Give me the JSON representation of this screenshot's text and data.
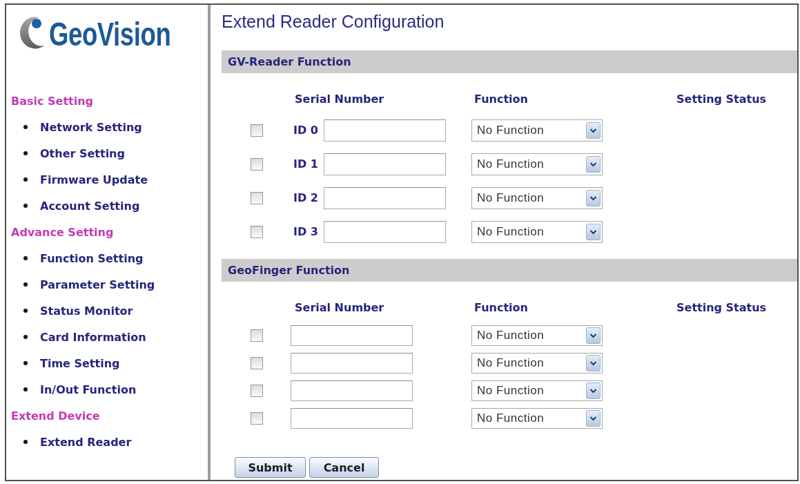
{
  "logo": {
    "text": "GeoVision"
  },
  "sidebar": {
    "groups": [
      {
        "title": "Basic Setting",
        "items": [
          "Network Setting",
          "Other Setting",
          "Firmware Update",
          "Account Setting"
        ]
      },
      {
        "title": "Advance Setting",
        "items": [
          "Function Setting",
          "Parameter Setting",
          "Status Monitor",
          "Card Information",
          "Time Setting",
          "In/Out Function"
        ]
      },
      {
        "title": "Extend Device",
        "items": [
          "Extend Reader"
        ]
      }
    ]
  },
  "page": {
    "title": "Extend Reader Configuration",
    "sections": [
      {
        "title": "GV-Reader Function",
        "columns": [
          "Serial Number",
          "Function",
          "Setting Status"
        ],
        "rows": [
          {
            "id_label": "ID 0",
            "checked": false,
            "function": "No Function"
          },
          {
            "id_label": "ID 1",
            "checked": false,
            "function": "No Function"
          },
          {
            "id_label": "ID 2",
            "checked": false,
            "function": "No Function"
          },
          {
            "id_label": "ID 3",
            "checked": false,
            "function": "No Function"
          }
        ]
      },
      {
        "title": "GeoFinger Function",
        "columns": [
          "Serial Number",
          "Function",
          "Setting Status"
        ],
        "rows": [
          {
            "checked": false,
            "function": "No Function"
          },
          {
            "checked": false,
            "function": "No Function"
          },
          {
            "checked": false,
            "function": "No Function"
          },
          {
            "checked": false,
            "function": "No Function"
          }
        ]
      }
    ],
    "buttons": [
      "Submit",
      "Cancel"
    ]
  }
}
